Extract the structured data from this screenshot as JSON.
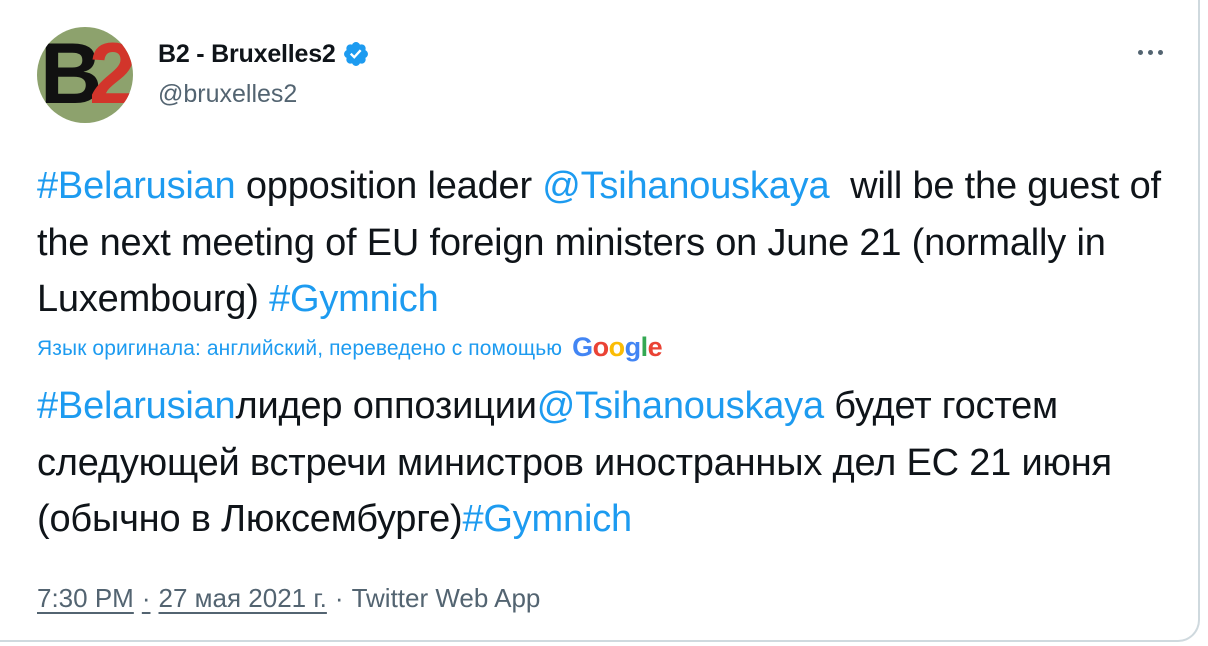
{
  "author": {
    "avatar_text_b": "B",
    "avatar_text_2": "2",
    "display_name": "B2 - Bruxelles2",
    "handle": "@bruxelles2",
    "verified": true
  },
  "tweet": {
    "segments": [
      {
        "text": "#Belarusian",
        "link": true
      },
      {
        "text": " opposition leader ",
        "link": false
      },
      {
        "text": "@Tsihanouskaya",
        "link": true
      },
      {
        "text": "  will be the guest of the next meeting of EU foreign ministers on June 21 (normally in Luxembourg) ",
        "link": false
      },
      {
        "text": "#Gymnich",
        "link": true
      }
    ]
  },
  "translation": {
    "label": "Язык оригинала: английский, переведено с помощью",
    "provider": {
      "letters": [
        "G",
        "o",
        "o",
        "g",
        "l",
        "e"
      ]
    },
    "segments": [
      {
        "text": "#Belarusian",
        "link": true
      },
      {
        "text": "лидер оппозиции",
        "link": false
      },
      {
        "text": "@Tsihanouskaya",
        "link": true
      },
      {
        "text": " будет гостем следующей встречи министров иностранных дел ЕС 21 июня (обычно в Люксембурге)",
        "link": false
      },
      {
        "text": "#Gymnich",
        "link": true
      }
    ]
  },
  "meta": {
    "time": "7:30 PM",
    "separator": "·",
    "date": "27 мая 2021 г.",
    "source": "Twitter Web App"
  },
  "colors": {
    "link": "#1d9bf0",
    "verified": "#1d9bf0",
    "secondary_text": "#536471",
    "avatar_bg": "#8da26d",
    "avatar_accent": "#d2352b"
  },
  "icons": {
    "verified": "verified-badge-icon",
    "more": "more-horizontal-icon"
  }
}
